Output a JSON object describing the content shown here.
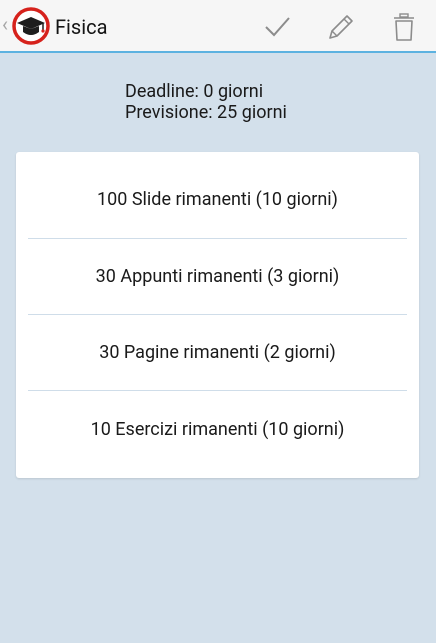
{
  "action_bar": {
    "title": "Fisica",
    "app_icon": "graduation-cap-icon",
    "actions": [
      {
        "name": "confirm",
        "icon": "checkmark-icon"
      },
      {
        "name": "edit",
        "icon": "pencil-icon"
      },
      {
        "name": "delete",
        "icon": "trash-icon"
      }
    ]
  },
  "info": {
    "deadline": "Deadline: 0 giorni",
    "forecast": "Previsione: 25 giorni"
  },
  "tasks": [
    {
      "label": "100 Slide rimanenti (10 giorni)"
    },
    {
      "label": "30 Appunti rimanenti (3 giorni)"
    },
    {
      "label": "30 Pagine rimanenti (2 giorni)"
    },
    {
      "label": "10 Esercizi rimanenti (10 giorni)"
    }
  ],
  "colors": {
    "background": "#d3e0eb",
    "action_bar": "#f6f6f6",
    "accent": "#5cb2e0",
    "icon_red": "#d6221c",
    "action_icon_gray": "#8c8c8c"
  }
}
